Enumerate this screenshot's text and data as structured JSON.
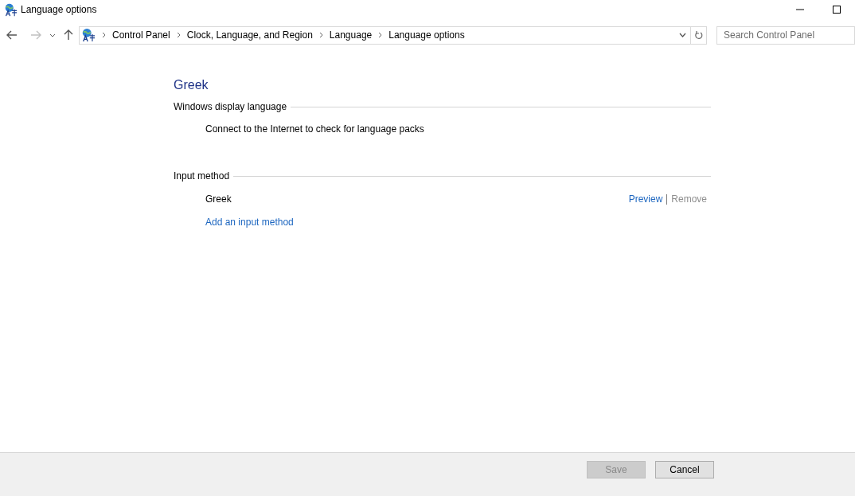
{
  "window": {
    "title": "Language options"
  },
  "nav": {
    "back_disabled": false,
    "forward_disabled": true,
    "breadcrumbs": [
      "Control Panel",
      "Clock, Language, and Region",
      "Language",
      "Language options"
    ],
    "search": {
      "placeholder": "Search Control Panel"
    }
  },
  "language": "Greek",
  "display_section": {
    "heading": "Windows display language",
    "message": "Connect to the Internet to check for language packs"
  },
  "input_section": {
    "heading": "Input method",
    "methods": [
      {
        "name": "Greek",
        "links": [
          {
            "label": "Preview",
            "disabled": false
          },
          {
            "label": "Remove",
            "disabled": true
          }
        ]
      }
    ],
    "add_link": "Add an input method"
  },
  "buttons": [
    {
      "label": "Save",
      "disabled": true
    },
    {
      "label": "Cancel",
      "disabled": false
    }
  ]
}
